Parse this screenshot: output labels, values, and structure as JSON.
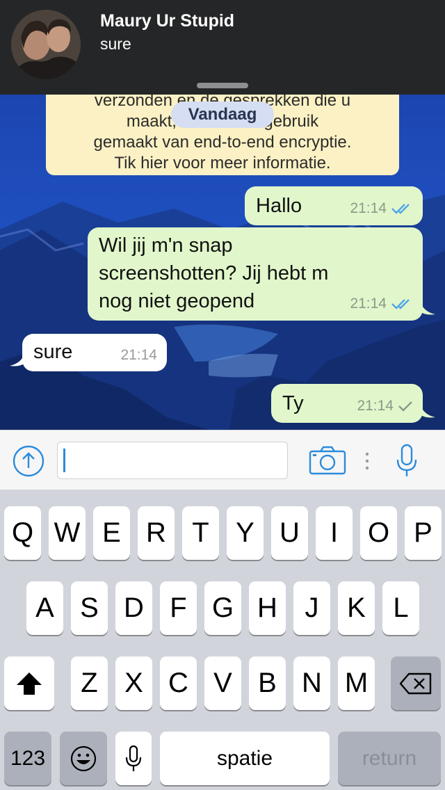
{
  "notification": {
    "contact_name": "Maury Ur Stupid",
    "message_preview": "sure"
  },
  "chat": {
    "encryption_notice": [
      "verzonden en de gesprekken die u",
      "maakt, worden nu gebruik",
      "gemaakt van end-to-end encryptie.",
      "Tik hier voor meer informatie."
    ],
    "date_label": "Vandaag",
    "messages": [
      {
        "direction": "out",
        "lines": [
          "Hallo"
        ],
        "time": "21:14",
        "status": "read"
      },
      {
        "direction": "out",
        "lines": [
          "Wil jij m'n snap",
          "screenshotten? Jij hebt m",
          "nog niet geopend"
        ],
        "time": "21:14",
        "status": "read"
      },
      {
        "direction": "in",
        "lines": [
          "sure"
        ],
        "time": "21:14"
      },
      {
        "direction": "out",
        "lines": [
          "Ty"
        ],
        "time": "21:14",
        "status": "sent"
      }
    ]
  },
  "input_bar": {
    "message_text": "",
    "icons": [
      "share-icon",
      "camera-icon",
      "more-icon",
      "microphone-icon"
    ],
    "accent_color": "#2b8bdb"
  },
  "keyboard": {
    "row1": [
      "Q",
      "W",
      "E",
      "R",
      "T",
      "Y",
      "U",
      "I",
      "O",
      "P"
    ],
    "row2": [
      "A",
      "S",
      "D",
      "F",
      "G",
      "H",
      "J",
      "K",
      "L"
    ],
    "row3": [
      "Z",
      "X",
      "C",
      "V",
      "B",
      "N",
      "M"
    ],
    "numbers_label": "123",
    "space_label": "spatie",
    "return_label": "return"
  },
  "colors": {
    "outgoing_bubble": "#e1f7cb",
    "incoming_bubble": "#ffffff",
    "read_check": "#4fa6e8",
    "sent_check": "#8a9a88"
  }
}
